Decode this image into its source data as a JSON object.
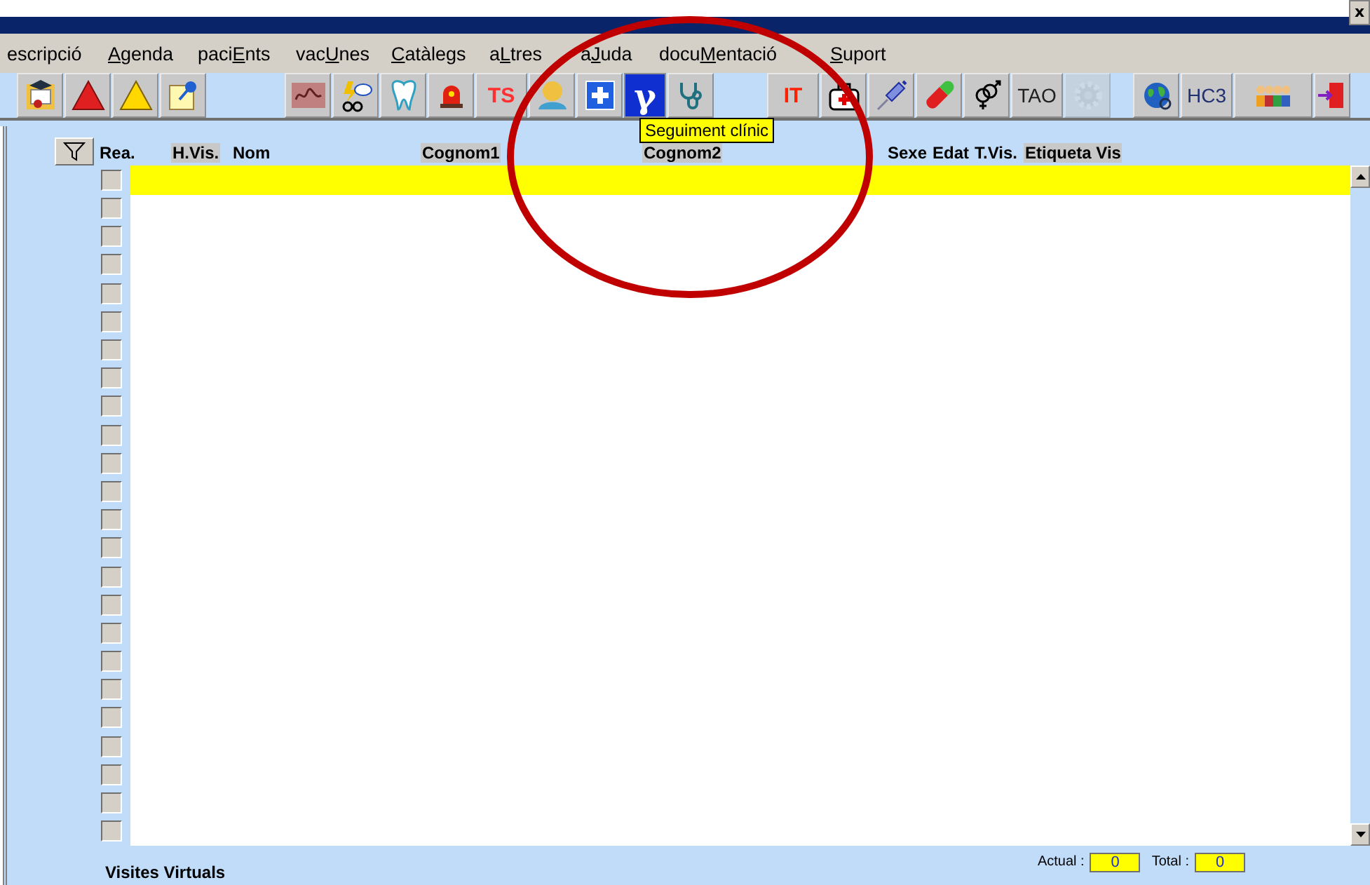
{
  "title_bar": {
    "close": "x"
  },
  "menu": [
    {
      "before": "escripció"
    },
    {
      "key": "A",
      "after": "genda"
    },
    {
      "before": "paci",
      "key": "E",
      "after": "nts"
    },
    {
      "before": "vac",
      "key": "U",
      "after": "nes"
    },
    {
      "key": "C",
      "after": "atàlegs"
    },
    {
      "before": "a",
      "key": "L",
      "after": "tres"
    },
    {
      "before": "a",
      "key": "J",
      "after": "uda"
    },
    {
      "before": "docu",
      "key": "M",
      "after": "entació"
    },
    {
      "key": "S",
      "after": "uport"
    }
  ],
  "toolbar": [
    [
      {
        "kind": "diploma",
        "disabled": false
      },
      {
        "kind": "danger",
        "disabled": false
      },
      {
        "kind": "warning",
        "disabled": false
      },
      {
        "kind": "note",
        "disabled": false
      }
    ],
    [
      {
        "kind": "signature",
        "disabled": false
      },
      {
        "kind": "glasses",
        "disabled": false
      },
      {
        "kind": "tooth",
        "disabled": false
      },
      {
        "kind": "siren",
        "disabled": false
      },
      {
        "kind": "text",
        "label": "TS",
        "color": "#ff3030",
        "disabled": false
      },
      {
        "kind": "bust",
        "disabled": false
      },
      {
        "kind": "plus",
        "disabled": false
      },
      {
        "kind": "glyph",
        "label": "γ",
        "disabled": false
      },
      {
        "kind": "stethoscope",
        "disabled": false
      }
    ],
    [
      {
        "kind": "text",
        "label": "IT",
        "color": "#ff2000",
        "disabled": false
      },
      {
        "kind": "bag",
        "disabled": false
      },
      {
        "kind": "syringe",
        "disabled": false
      },
      {
        "kind": "pill",
        "disabled": false
      },
      {
        "kind": "gender",
        "disabled": false
      },
      {
        "kind": "text",
        "label": "TAO",
        "color": "#202020",
        "disabled": false
      },
      {
        "kind": "gear",
        "disabled": true
      }
    ],
    [
      {
        "kind": "globe",
        "disabled": false
      },
      {
        "kind": "text",
        "label": "HC3",
        "color": "#203070",
        "disabled": false
      },
      {
        "kind": "people",
        "disabled": false
      },
      {
        "kind": "exit",
        "disabled": false
      }
    ]
  ],
  "tooltip": "Seguiment clínic",
  "columns": [
    {
      "label": "Rea.",
      "shaded": false
    },
    {
      "label": "H.Vis.",
      "shaded": true
    },
    {
      "label": "Nom",
      "shaded": false
    },
    {
      "label": "Cognom1",
      "shaded": true
    },
    {
      "label": "Cognom2",
      "shaded": true
    },
    {
      "label": "Sexe",
      "shaded": false
    },
    {
      "label": "Edat",
      "shaded": false
    },
    {
      "label": "T.Vis.",
      "shaded": false
    },
    {
      "label": "Etiqueta Vis",
      "shaded": true
    }
  ],
  "rows": [
    {
      "checked": false,
      "selected": true
    },
    {
      "checked": false,
      "selected": false
    },
    {
      "checked": false,
      "selected": false
    },
    {
      "checked": false,
      "selected": false
    },
    {
      "checked": false,
      "selected": false
    },
    {
      "checked": false,
      "selected": false
    },
    {
      "checked": false,
      "selected": false
    },
    {
      "checked": false,
      "selected": false
    },
    {
      "checked": false,
      "selected": false
    },
    {
      "checked": false,
      "selected": false
    },
    {
      "checked": false,
      "selected": false
    },
    {
      "checked": false,
      "selected": false
    },
    {
      "checked": false,
      "selected": false
    },
    {
      "checked": false,
      "selected": false
    },
    {
      "checked": false,
      "selected": false
    },
    {
      "checked": false,
      "selected": false
    },
    {
      "checked": false,
      "selected": false
    },
    {
      "checked": false,
      "selected": false
    },
    {
      "checked": false,
      "selected": false
    },
    {
      "checked": false,
      "selected": false
    },
    {
      "checked": false,
      "selected": false
    },
    {
      "checked": false,
      "selected": false
    },
    {
      "checked": false,
      "selected": false
    },
    {
      "checked": false,
      "selected": false
    }
  ],
  "footer": {
    "title": "Visites Virtuals",
    "actual_label": "Actual :",
    "actual": "0",
    "total_label": "Total :",
    "total": "0"
  },
  "annotation": {
    "kind": "ellipse",
    "color": "#c00000"
  }
}
